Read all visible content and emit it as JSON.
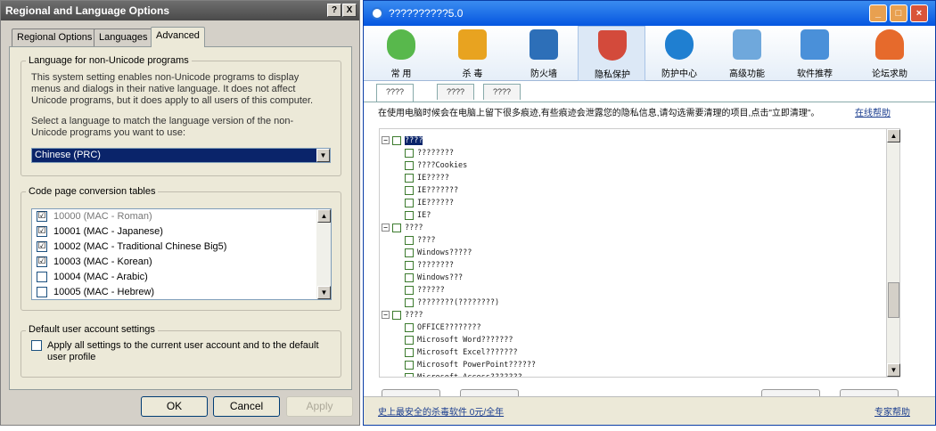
{
  "dialog": {
    "title": "Regional and Language Options",
    "help_button": "?",
    "close_button": "X",
    "tabs": [
      "Regional Options",
      "Languages",
      "Advanced"
    ],
    "nonunicode": {
      "legend": "Language for non-Unicode programs",
      "text1": "This system setting enables non-Unicode programs to display menus and dialogs in their native language. It does not affect Unicode programs, but it does apply to all users of this computer.",
      "text2": "Select a language to match the language version of the non-Unicode programs you want to use:",
      "selected_language": "Chinese (PRC)"
    },
    "codepage": {
      "legend": "Code page conversion tables",
      "items": [
        {
          "label": "10000 (MAC - Roman)",
          "checked": "☑",
          "disabled": true
        },
        {
          "label": "10001 (MAC - Japanese)",
          "checked": "☑",
          "disabled": false
        },
        {
          "label": "10002 (MAC - Traditional Chinese Big5)",
          "checked": "☑",
          "disabled": false
        },
        {
          "label": "10003 (MAC - Korean)",
          "checked": "☑",
          "disabled": false
        },
        {
          "label": "10004 (MAC - Arabic)",
          "checked": "",
          "disabled": false
        },
        {
          "label": "10005 (MAC - Hebrew)",
          "checked": "",
          "disabled": false
        }
      ]
    },
    "default_user": {
      "legend": "Default user account settings",
      "checkbox_label": "Apply all settings to the current user account and to the default user profile"
    },
    "buttons": {
      "ok": "OK",
      "cancel": "Cancel",
      "apply": "Apply"
    }
  },
  "app": {
    "title": "??????????5.0",
    "toolbar": [
      {
        "label": "常 用",
        "icon": "mouse-icon",
        "color": "#58b84c"
      },
      {
        "label": "杀 毒",
        "icon": "shield-bug-icon",
        "color": "#e8a320"
      },
      {
        "label": "防火墙",
        "icon": "firewall-icon",
        "color": "#2d6fb8"
      },
      {
        "label": "隐私保护",
        "icon": "privacy-shield-icon",
        "color": "#d34a3b"
      },
      {
        "label": "防护中心",
        "icon": "protection-center-icon",
        "color": "#1f7fd1"
      },
      {
        "label": "高级功能",
        "icon": "advanced-blocks-icon",
        "color": "#6fa8dc"
      },
      {
        "label": "软件推荐",
        "icon": "software-window-icon",
        "color": "#4a90d9"
      },
      {
        "label": "论坛求助",
        "icon": "forum-heart-icon",
        "color": "#e66a2c"
      }
    ],
    "subtabs": [
      "????",
      "????",
      "????"
    ],
    "description": "在使用电脑时候会在电脑上留下很多痕迹,有些痕迹会泄露您的隐私信息,请勾选需要清理的项目,点击\"立即清理\"。",
    "help_link": "在线帮助",
    "tree": [
      {
        "level": 0,
        "label": "????",
        "expander": "−",
        "highlighted": true
      },
      {
        "level": 1,
        "label": "????????"
      },
      {
        "level": 1,
        "label": "????Cookies"
      },
      {
        "level": 1,
        "label": "IE?????"
      },
      {
        "level": 1,
        "label": "IE???????"
      },
      {
        "level": 1,
        "label": "IE??????"
      },
      {
        "level": 1,
        "label": "IE?"
      },
      {
        "level": 0,
        "label": "????",
        "expander": "−"
      },
      {
        "level": 1,
        "label": "????"
      },
      {
        "level": 1,
        "label": "Windows?????"
      },
      {
        "level": 1,
        "label": "????????"
      },
      {
        "level": 1,
        "label": "Windows???"
      },
      {
        "level": 1,
        "label": "??????"
      },
      {
        "level": 1,
        "label": "????????(????????)"
      },
      {
        "level": 0,
        "label": "????",
        "expander": "−"
      },
      {
        "level": 1,
        "label": "OFFICE????????"
      },
      {
        "level": 1,
        "label": "Microsoft Word???????"
      },
      {
        "level": 1,
        "label": "Microsoft Excel???????"
      },
      {
        "level": 1,
        "label": "Microsoft PowerPoint??????"
      },
      {
        "level": 1,
        "label": "Microsoft Access???????"
      }
    ],
    "status_left": "史上最安全的杀毒软件 0元/全年",
    "status_right": "专家帮助"
  }
}
